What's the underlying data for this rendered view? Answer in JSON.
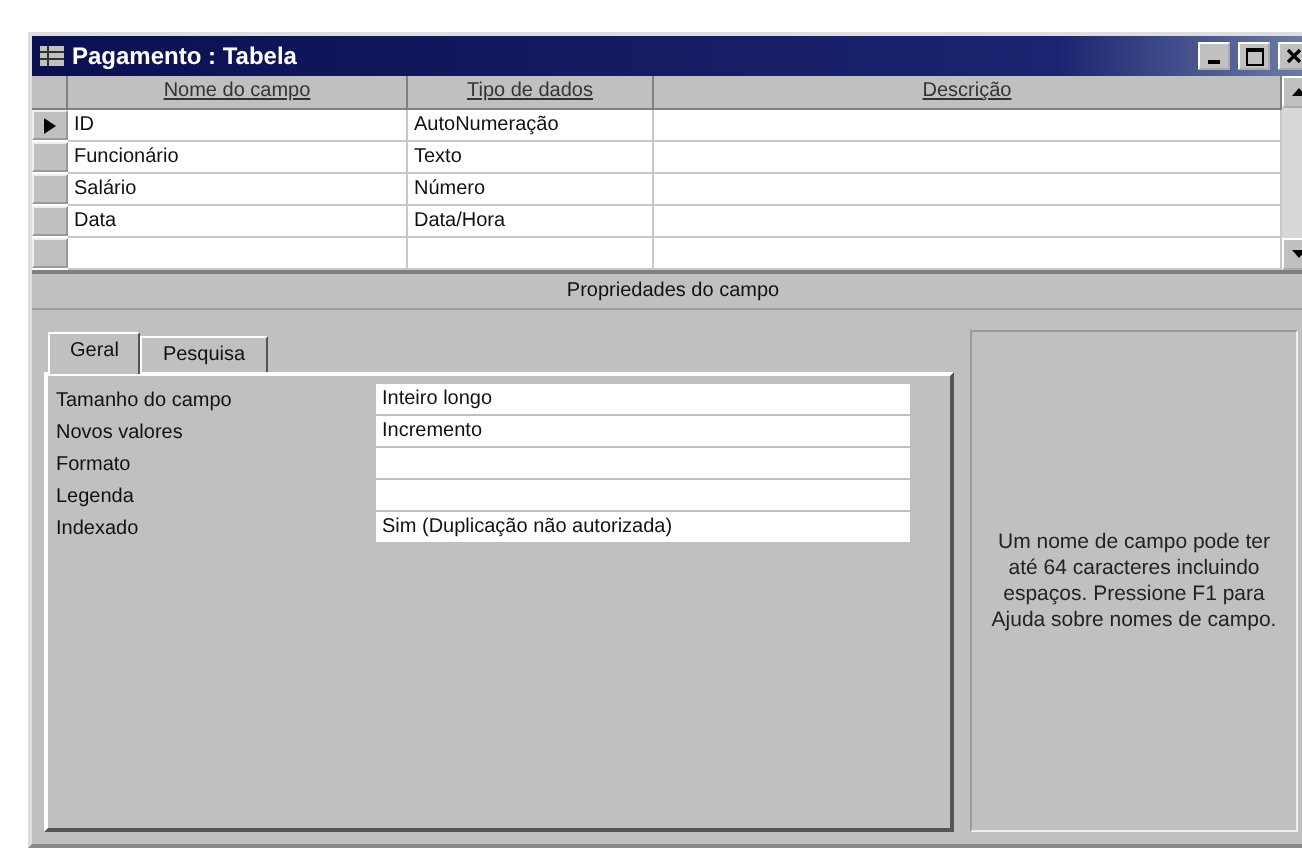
{
  "window": {
    "title": "Pagamento : Tabela"
  },
  "grid": {
    "columns": [
      "Nome do campo",
      "Tipo de dados",
      "Descrição"
    ],
    "rows": [
      {
        "name": "ID",
        "type": "AutoNumeração",
        "current": true
      },
      {
        "name": "Funcionário",
        "type": "Texto",
        "current": false
      },
      {
        "name": "Salário",
        "type": "Número",
        "current": false
      },
      {
        "name": "Data",
        "type": "Data/Hora",
        "current": false
      }
    ]
  },
  "properties_title": "Propriedades do campo",
  "tabs": [
    {
      "label": "Geral",
      "selected": true
    },
    {
      "label": "Pesquisa",
      "selected": false
    }
  ],
  "properties": [
    {
      "label": "Tamanho do campo",
      "value": "Inteiro longo"
    },
    {
      "label": "Novos valores",
      "value": "Incremento"
    },
    {
      "label": "Formato"
    },
    {
      "label": "Legenda"
    },
    {
      "label": "Indexado",
      "value": "Sim (Duplicação não autorizada)"
    }
  ],
  "help": "Um nome de campo pode ter até 64 caracteres incluindo espaços. Pressione F1 para Ajuda sobre nomes de campo."
}
